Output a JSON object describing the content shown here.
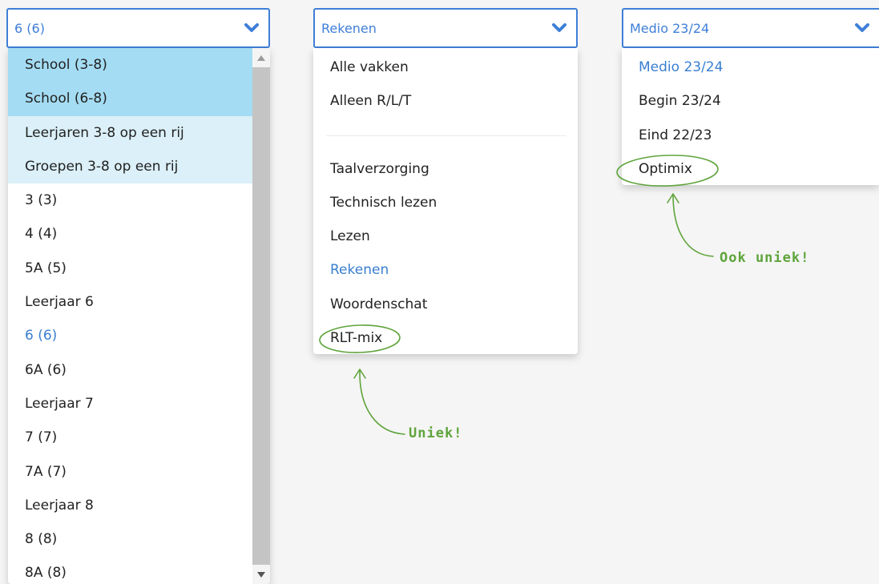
{
  "selects": {
    "class": {
      "value": "6 (6)",
      "options": [
        "School (3-8)",
        "School (6-8)",
        "Leerjaren 3-8 op een rij",
        "Groepen 3-8 op een rij",
        "3 (3)",
        "4 (4)",
        "5A (5)",
        "Leerjaar 6",
        "6 (6)",
        "6A (6)",
        "Leerjaar 7",
        "7 (7)",
        "7A (7)",
        "Leerjaar 8",
        "8 (8)",
        "8A (8)"
      ]
    },
    "subject": {
      "value": "Rekenen",
      "options_top": [
        "Alle vakken",
        "Alleen R/L/T"
      ],
      "options": [
        "Taalverzorging",
        "Technisch lezen",
        "Lezen",
        "Rekenen",
        "Woordenschat",
        "RLT-mix"
      ]
    },
    "period": {
      "value": "Medio 23/24",
      "options": [
        "Medio 23/24",
        "Begin 23/24",
        "Eind 22/23",
        "Optimix"
      ]
    }
  },
  "annotations": {
    "unique": "Uniek!",
    "also_unique": "Ook uniek!"
  },
  "colors": {
    "accent": "#3e7fd8",
    "highlight_dark": "#a4dcf3",
    "highlight_light": "#dbf0f8",
    "annotation": "#5fa43c"
  },
  "icons": {
    "dropdown": "chevron-down-icon",
    "scroll_up": "triangle-up-icon",
    "scroll_down": "triangle-down-icon"
  }
}
